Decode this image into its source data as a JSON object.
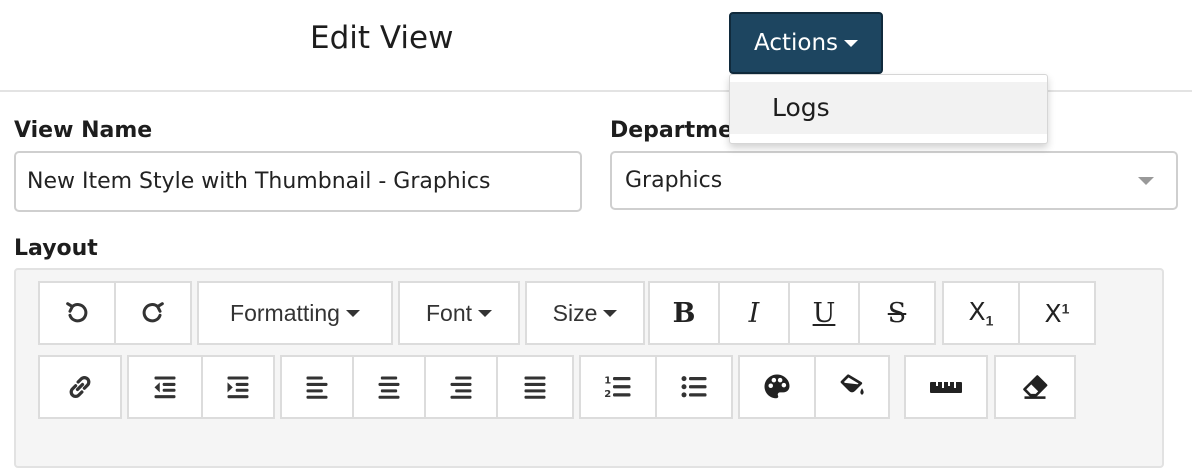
{
  "header": {
    "title": "Edit View",
    "actions_label": "Actions",
    "menu": [
      {
        "label": "Logs"
      }
    ]
  },
  "form": {
    "view_name_label": "View Name",
    "view_name_value": "New Item Style with Thumbnail - Graphics",
    "department_label": "Department",
    "department_value": "Graphics",
    "layout_label": "Layout"
  },
  "toolbar": {
    "formatting_label": "Formatting",
    "font_label": "Font",
    "size_label": "Size",
    "bold_glyph": "B",
    "italic_glyph": "I",
    "underline_glyph": "U",
    "strike_glyph": "S",
    "subscript_glyph": "X",
    "subscript_mark": "1",
    "superscript_glyph": "X",
    "superscript_mark": "1",
    "icons": [
      "undo-icon",
      "redo-icon",
      "link-icon",
      "outdent-icon",
      "indent-icon",
      "align-left-icon",
      "align-center-icon",
      "align-right-icon",
      "align-justify-icon",
      "ordered-list-icon",
      "unordered-list-icon",
      "palette-icon",
      "fill-bucket-icon",
      "ruler-icon",
      "eraser-icon"
    ]
  },
  "colors": {
    "accent": "#1d4560",
    "border": "#cfcfcf"
  }
}
